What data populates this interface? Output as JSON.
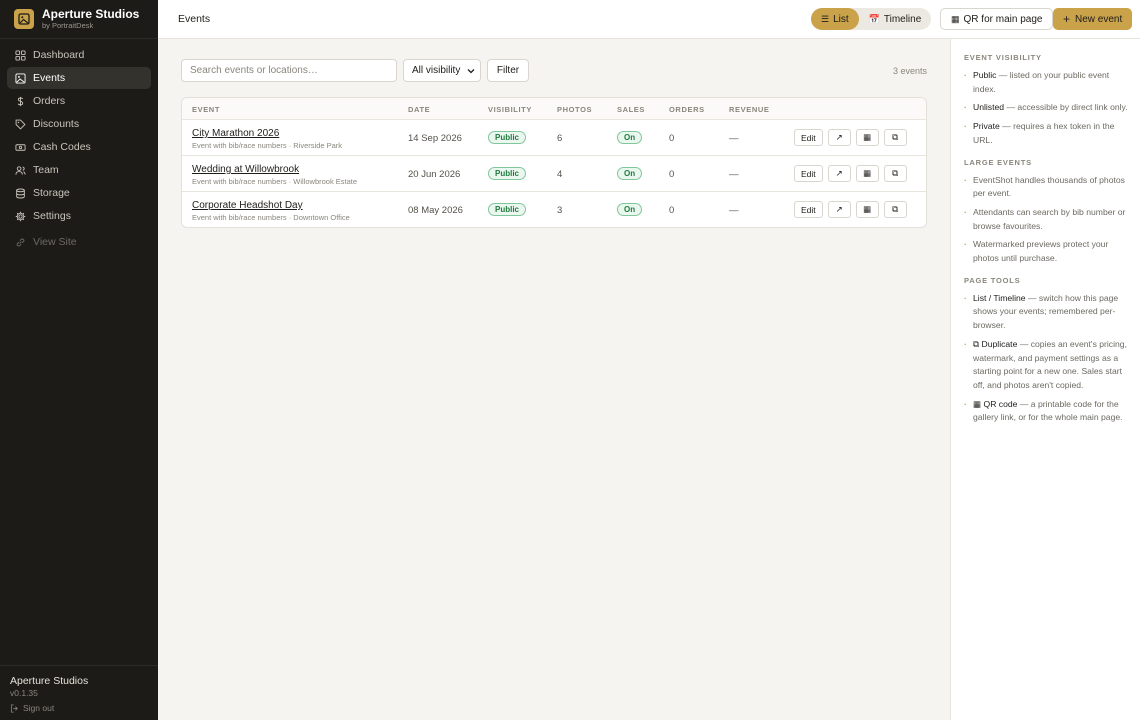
{
  "brand": {
    "name": "Aperture Studios",
    "sub": "by PortraitDesk"
  },
  "nav": [
    {
      "label": "Dashboard",
      "icon": "grid-icon"
    },
    {
      "label": "Events",
      "icon": "image-icon"
    },
    {
      "label": "Orders",
      "icon": "dollar-icon"
    },
    {
      "label": "Discounts",
      "icon": "tag-icon"
    },
    {
      "label": "Cash Codes",
      "icon": "ticket-icon"
    },
    {
      "label": "Team",
      "icon": "users-icon"
    },
    {
      "label": "Storage",
      "icon": "database-icon"
    },
    {
      "label": "Settings",
      "icon": "gear-icon"
    },
    {
      "label": "View Site",
      "icon": "link-icon"
    }
  ],
  "footer": {
    "studio": "Aperture Studios",
    "version": "v0.1.35",
    "signout": "Sign out"
  },
  "header": {
    "title": "Events",
    "view_list": "List",
    "view_timeline": "Timeline",
    "qr_main": "QR for main page",
    "new_event": "New event"
  },
  "toolbar": {
    "search_placeholder": "Search events or locations…",
    "visibility_selected": "All visibility",
    "filter": "Filter",
    "count": "3 events"
  },
  "table": {
    "columns": [
      "EVENT",
      "DATE",
      "VISIBILITY",
      "PHOTOS",
      "SALES",
      "ORDERS",
      "REVENUE"
    ],
    "rows": [
      {
        "name": "City Marathon 2026",
        "sub": "Event with bib/race numbers · Riverside Park",
        "date": "14 Sep 2026",
        "visibility": "Public",
        "photos": "6",
        "sales": "On",
        "orders": "0",
        "revenue": "—"
      },
      {
        "name": "Wedding at Willowbrook",
        "sub": "Event with bib/race numbers · Willowbrook Estate",
        "date": "20 Jun 2026",
        "visibility": "Public",
        "photos": "4",
        "sales": "On",
        "orders": "0",
        "revenue": "—"
      },
      {
        "name": "Corporate Headshot Day",
        "sub": "Event with bib/race numbers · Downtown Office",
        "date": "08 May 2026",
        "visibility": "Public",
        "photos": "3",
        "sales": "On",
        "orders": "0",
        "revenue": "—"
      }
    ],
    "actions": {
      "edit": "Edit",
      "open": "↗",
      "qr": "▦",
      "duplicate": "⧉"
    }
  },
  "panel": {
    "visibility": {
      "title": "EVENT VISIBILITY",
      "tips": [
        {
          "key": "Public",
          "text": " — listed on your public event index."
        },
        {
          "key": "Unlisted",
          "text": " — accessible by direct link only."
        },
        {
          "key": "Private",
          "text": " — requires a hex token in the URL."
        }
      ]
    },
    "large": {
      "title": "LARGE EVENTS",
      "tips": [
        "EventShot handles thousands of photos per event.",
        "Attendants can search by bib number or browse favourites.",
        "Watermarked previews protect your photos until purchase."
      ]
    },
    "tools": {
      "title": "PAGE TOOLS",
      "tips": [
        {
          "key": "List / Timeline",
          "text": " — switch how this page shows your events; remembered per-browser."
        },
        {
          "key": "⧉ Duplicate",
          "text": " — copies an event's pricing, watermark, and payment settings as a starting point for a new one. Sales start off, and photos aren't copied."
        },
        {
          "key": "▦ QR code",
          "text": " — a printable code for the gallery link, or for the whole main page."
        }
      ]
    }
  },
  "colors": {
    "accent": "#c9a24a",
    "sidebar": "#1c1b18",
    "badge_green": "#1f7a3f"
  }
}
